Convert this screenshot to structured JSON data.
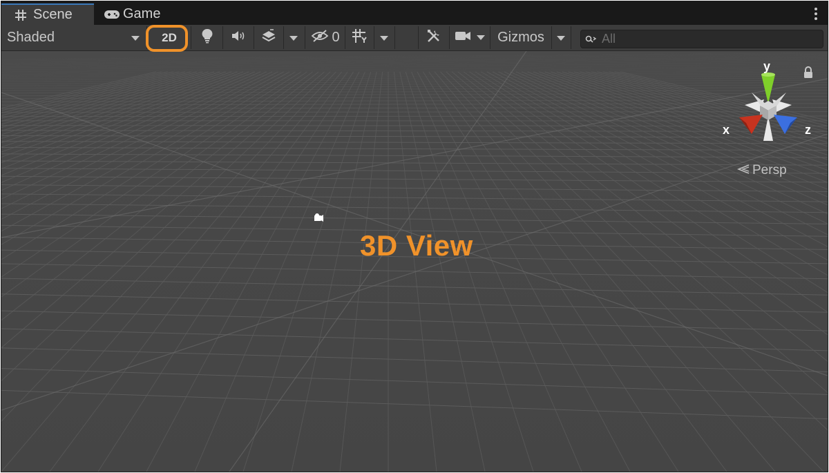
{
  "tabs": [
    {
      "label": "Scene",
      "icon": "grid-hash-icon",
      "active": true
    },
    {
      "label": "Game",
      "icon": "gamepad-icon",
      "active": false
    }
  ],
  "toolbar": {
    "draw_mode": "Shaded",
    "toggle_2d": "2D",
    "hidden_count": "0",
    "gizmos": "Gizmos",
    "search_placeholder": "All"
  },
  "scene": {
    "projection_label": "Persp",
    "overlay_label": "3D View",
    "axes": {
      "x": "x",
      "y": "y",
      "z": "z"
    }
  },
  "colors": {
    "highlight": "#f0922a",
    "x_axis": "#c8331f",
    "y_axis": "#7fcf2a",
    "z_axis": "#3b6fe0",
    "background": "#454545"
  }
}
